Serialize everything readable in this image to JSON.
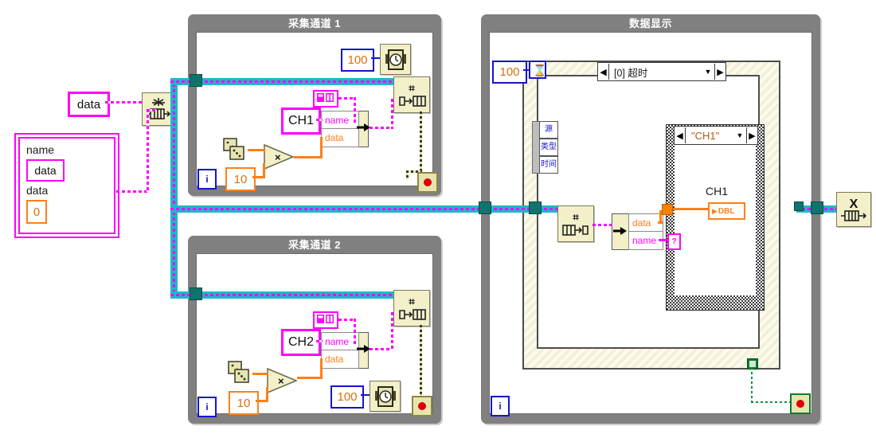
{
  "diagram": {
    "type": "labview-block-diagram",
    "background": "#ffffff"
  },
  "structures": [
    {
      "id": "loop1",
      "title": "采集通道 1",
      "kind": "while-loop"
    },
    {
      "id": "loop2",
      "title": "采集通道 2",
      "kind": "while-loop"
    },
    {
      "id": "loop3",
      "title": "数据显示",
      "kind": "while-loop"
    }
  ],
  "loop1": {
    "title": "采集通道 1",
    "iteration_label": "i",
    "wait_ms": "100",
    "multiplier": "10",
    "channel_name": "CH1",
    "bundle_fields": {
      "name": "name",
      "data": "data"
    },
    "icons": {
      "wait": "clock-icon",
      "random": "dice-icon",
      "multiply": "multiply-icon",
      "enqueue": "enqueue-element-icon",
      "stop": "stop-button-icon",
      "cluster_const": "cluster-constant-icon"
    }
  },
  "loop2": {
    "title": "采集通道 2",
    "iteration_label": "i",
    "wait_ms": "100",
    "multiplier": "10",
    "channel_name": "CH2",
    "bundle_fields": {
      "name": "name",
      "data": "data"
    },
    "icons": {
      "wait": "clock-icon",
      "random": "dice-icon",
      "multiply": "multiply-icon",
      "enqueue": "enqueue-element-icon",
      "stop": "stop-button-icon",
      "cluster_const": "cluster-constant-icon"
    }
  },
  "loop3": {
    "title": "数据显示",
    "iteration_label": "i",
    "timeout_ms": "100",
    "event_case_label": "[0] 超时",
    "event_data_node": [
      "源",
      "类型",
      "时间"
    ],
    "case_selector_label": "\"CH1\"",
    "unbundle_fields": {
      "data": "data",
      "name": "name"
    },
    "indicator_label": "CH1",
    "indicator_type": "DBL",
    "comparison_marker": "?",
    "icons": {
      "timeout_terminal": "hourglass-icon",
      "dequeue": "dequeue-element-icon",
      "unbundle": "unbundle-by-name-icon",
      "stop": "stop-button-icon"
    }
  },
  "left_panel": {
    "queue_name_constant": "data",
    "cluster_label_name": "name",
    "cluster_name_value": "data",
    "cluster_label_data": "data",
    "cluster_data_value": "0",
    "obtain_queue_icon": "obtain-queue-icon"
  },
  "right_panel": {
    "release_queue_icon": "release-queue-icon"
  },
  "colors": {
    "structure_frame": "#808080",
    "node_fill": "#f2efc9",
    "queue_wire_casing": "#19b9c9",
    "queue_wire_core": "#ff00ff",
    "cluster_wire": "#ff00ff",
    "numeric_wire": "#ff7f19",
    "error_wire": "#6e6b2a",
    "boolean_wire": "#0f8f3c",
    "tunnel": "#10736e",
    "blue_constant_border": "#1515cf",
    "orange_constant_border": "#ff7f19"
  }
}
